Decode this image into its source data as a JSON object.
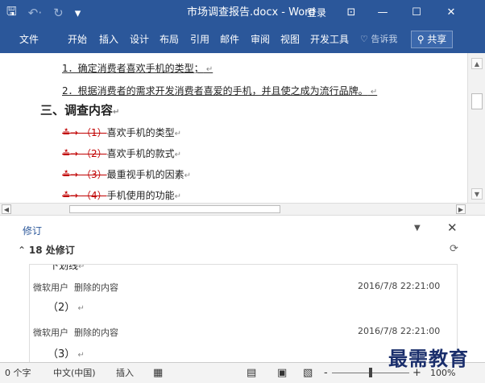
{
  "titlebar": {
    "save_icon": "save-icon",
    "undo_icon": "undo-icon",
    "redo_icon": "redo-icon",
    "title": "市场调查报告.docx - Word",
    "login": "登录",
    "buttons": [
      "ribbon-display-options",
      "minimize",
      "maximize",
      "close"
    ]
  },
  "ribbon": {
    "tabs": [
      "文件",
      "开始",
      "插入",
      "设计",
      "布局",
      "引用",
      "邮件",
      "审阅",
      "视图",
      "开发工具"
    ],
    "tellme": "告诉我",
    "share": "共享"
  },
  "document": {
    "lines": [
      "1．确定消费者喜欢手机的类型；",
      "2．根据消费者的需求开发消费者喜爱的手机，并且使之成为流行品牌。"
    ],
    "heading": "三、调查内容",
    "items": [
      {
        "marker": "（1）",
        "text": "喜欢手机的类型"
      },
      {
        "marker": "（2）",
        "text": "喜欢手机的款式"
      },
      {
        "marker": "（3）",
        "text": "最重视手机的因素"
      },
      {
        "marker": "（4）",
        "text": "手机使用的功能"
      }
    ]
  },
  "revisions_pane": {
    "title": "修订",
    "summary_count": "18 处修订",
    "top_fragment": "下划线",
    "entries": [
      {
        "author": "微软用户",
        "action": "删除的内容",
        "time": "2016/7/8 22:21:00",
        "content": "（2）"
      },
      {
        "author": "微软用户",
        "action": "删除的内容",
        "time": "2016/7/8 22:21:00",
        "content": "（3）"
      }
    ]
  },
  "statusbar": {
    "word_count": "0 个字",
    "language": "中文(中国)",
    "mode": "插入",
    "zoom_minus": "-",
    "zoom_plus": "+",
    "zoom": "100%"
  },
  "watermark": "最需教育",
  "colors": {
    "accent": "#2b579a",
    "revision": "#c00000"
  }
}
